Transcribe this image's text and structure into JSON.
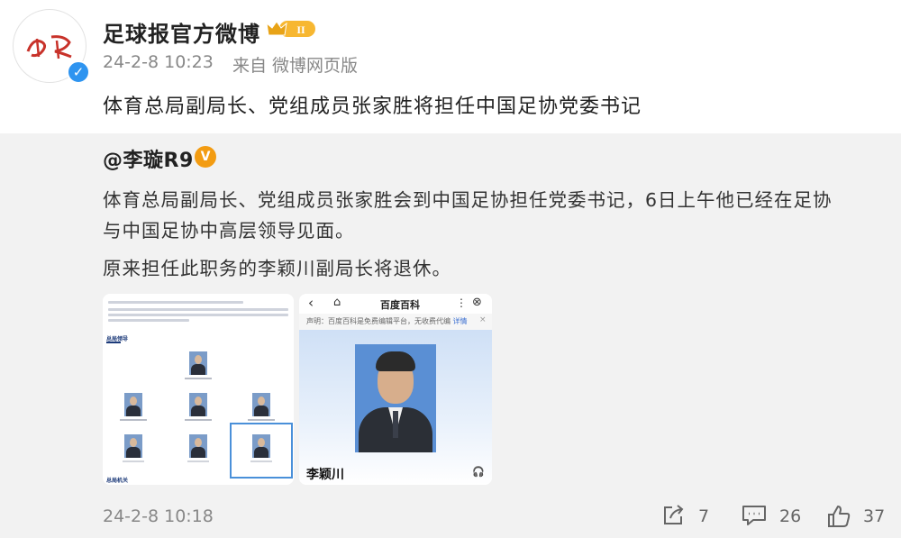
{
  "post": {
    "author": "足球报官方微博",
    "level_badge": "II",
    "time": "24-2-8 10:23",
    "source": "来自 微博网页版",
    "text": "体育总局副局长、党组成员张家胜将担任中国足协党委书记"
  },
  "repost": {
    "author": "@李璇R9",
    "badge_symbol": "V",
    "lines": [
      "体育总局副局长、党组成员张家胜会到中国足协担任党委书记，6日上午他已经在足协",
      "与中国足协中高层领导见面。",
      "原来担任此职务的李颖川副局长将退休。"
    ],
    "time": "24-2-8 10:18",
    "actions": {
      "share_count": "7",
      "comment_count": "26",
      "like_count": "37"
    },
    "baike": {
      "title": "百度百科",
      "notice": "声明：百度百科是免费编辑平台，无收费代编",
      "notice_link": "详情",
      "name": "李颖川"
    },
    "doc": {
      "heading": "总局领导",
      "footer": "总局机关"
    }
  },
  "colors": {
    "verified": "#2e94f0",
    "gold_badge": "#f39c12",
    "repost_bg": "#f2f2f2",
    "link": "#3b6fd1"
  }
}
